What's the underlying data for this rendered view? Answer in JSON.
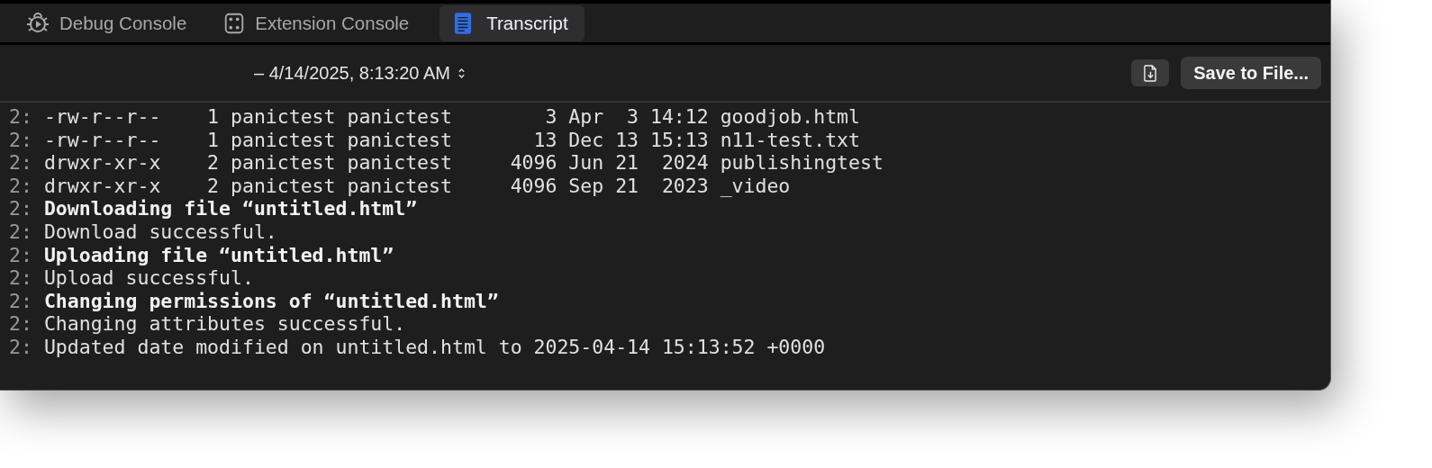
{
  "tabs": [
    {
      "label": "Debug Console",
      "kind": "bug",
      "selected": false
    },
    {
      "label": "Extension Console",
      "kind": "dice",
      "selected": false
    },
    {
      "label": "Transcript",
      "kind": "doc",
      "selected": true
    }
  ],
  "toolbar": {
    "date": "– 4/14/2025, 8:13:20 AM",
    "save_button": "Save to File..."
  },
  "log": [
    {
      "prefix": "2:",
      "text": "-rw-r--r--    1 panictest panictest        3 Apr  3 14:12 goodjob.html",
      "kind": "normal"
    },
    {
      "prefix": "2:",
      "text": "-rw-r--r--    1 panictest panictest       13 Dec 13 15:13 n11-test.txt",
      "kind": "normal"
    },
    {
      "prefix": "2:",
      "text": "drwxr-xr-x    2 panictest panictest     4096 Jun 21  2024 publishingtest",
      "kind": "normal"
    },
    {
      "prefix": "2:",
      "text": "drwxr-xr-x    2 panictest panictest     4096 Sep 21  2023 _video",
      "kind": "normal"
    },
    {
      "prefix": "2:",
      "text": "Downloading file “untitled.html”",
      "kind": "bold"
    },
    {
      "prefix": "2:",
      "text": "Download successful.",
      "kind": "normal"
    },
    {
      "prefix": "2:",
      "text": "Uploading file “untitled.html”",
      "kind": "bold"
    },
    {
      "prefix": "2:",
      "text": "Upload successful.",
      "kind": "normal"
    },
    {
      "prefix": "2:",
      "text": "Changing permissions of “untitled.html”",
      "kind": "bold"
    },
    {
      "prefix": "2:",
      "text": "Changing attributes successful.",
      "kind": "normal"
    },
    {
      "prefix": "2:",
      "text": "Updated date modified on untitled.html to 2025-04-14 15:13:52 +0000",
      "kind": "normal"
    }
  ]
}
